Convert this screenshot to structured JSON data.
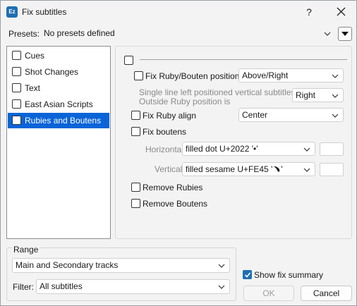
{
  "window": {
    "title": "Fix subtitles",
    "app_icon_text": "Ez",
    "help_label": "?"
  },
  "presets": {
    "label": "Presets:",
    "value": "No presets defined"
  },
  "categories": [
    {
      "label": "Cues",
      "checked": false,
      "selected": false
    },
    {
      "label": "Shot Changes",
      "checked": false,
      "selected": false
    },
    {
      "label": "Text",
      "checked": false,
      "selected": false
    },
    {
      "label": "East Asian Scripts",
      "checked": false,
      "selected": false
    },
    {
      "label": "Rubies and Boutens",
      "checked": false,
      "selected": true
    }
  ],
  "options": {
    "fix_ruby_bouten_positions": {
      "label": "Fix Ruby/Bouten positions",
      "checked": false,
      "value": "Above/Right"
    },
    "single_line_note": {
      "line1": "Single line left positioned vertical subtitles",
      "line2": "Outside Ruby position is",
      "value": "Right"
    },
    "fix_ruby_align": {
      "label": "Fix Ruby align",
      "checked": false,
      "value": "Center"
    },
    "fix_boutens": {
      "label": "Fix boutens",
      "checked": false
    },
    "horizontal": {
      "label": "Horizontal",
      "value": "filled dot U+2022 '•'"
    },
    "vertical": {
      "label": "Vertical",
      "value": "filled sesame U+FE45 '﹅'"
    },
    "remove_rubies": {
      "label": "Remove Rubies",
      "checked": false
    },
    "remove_boutens": {
      "label": "Remove Boutens",
      "checked": false
    }
  },
  "range": {
    "label": "Range",
    "tracks_value": "Main and Secondary tracks",
    "filter_label": "Filter:",
    "filter_value": "All subtitles"
  },
  "summary": {
    "label": "Show fix summary",
    "checked": true
  },
  "buttons": {
    "ok": "OK",
    "cancel": "Cancel"
  },
  "colors": {
    "accent": "#0a64d8",
    "checkbox_checked": "#1f6fb2"
  }
}
